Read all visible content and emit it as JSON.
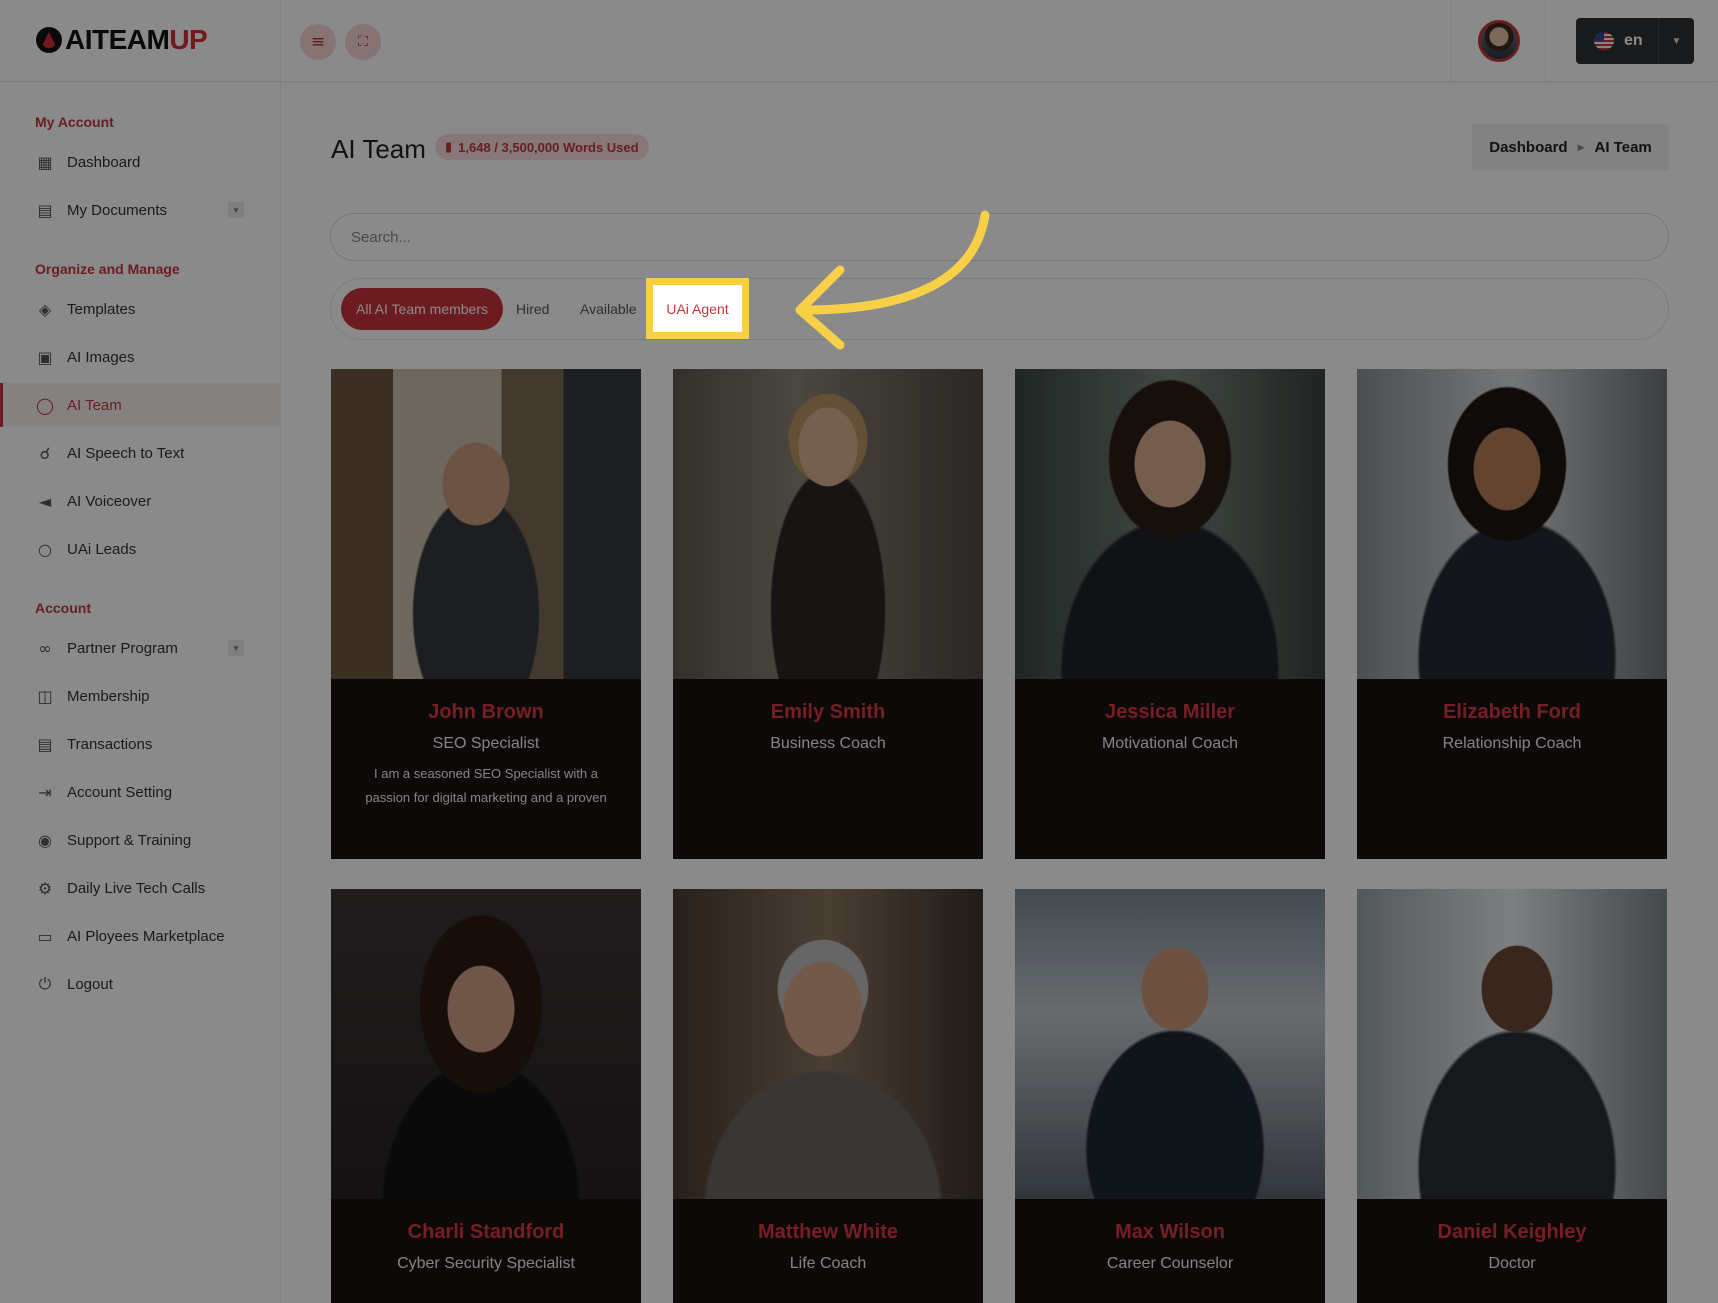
{
  "brand": {
    "name_main": "AITEAM",
    "name_accent": "UP"
  },
  "header": {
    "menu_icon": "hamburger-icon",
    "fullscreen_icon": "fullscreen-icon",
    "language_code": "en"
  },
  "sidebar": {
    "sections": [
      {
        "title": "My Account",
        "items": [
          {
            "label": "Dashboard",
            "icon": "grid-icon"
          },
          {
            "label": "My Documents",
            "icon": "document-icon",
            "has_dropdown": true
          }
        ]
      },
      {
        "title": "Organize and Manage",
        "items": [
          {
            "label": "Templates",
            "icon": "layers-icon"
          },
          {
            "label": "AI Images",
            "icon": "image-icon"
          },
          {
            "label": "AI Team",
            "icon": "chat-icon",
            "active": true
          },
          {
            "label": "AI Speech to Text",
            "icon": "headphones-icon"
          },
          {
            "label": "AI Voiceover",
            "icon": "speaker-icon"
          },
          {
            "label": "UAi Leads",
            "icon": "circle-icon"
          }
        ]
      },
      {
        "title": "Account",
        "items": [
          {
            "label": "Partner Program",
            "icon": "share-icon",
            "has_dropdown": true
          },
          {
            "label": "Membership",
            "icon": "gift-icon"
          },
          {
            "label": "Transactions",
            "icon": "receipt-icon"
          },
          {
            "label": "Account Setting",
            "icon": "exit-icon"
          },
          {
            "label": "Support & Training",
            "icon": "eye-icon"
          },
          {
            "label": "Daily Live Tech Calls",
            "icon": "gear-icon"
          },
          {
            "label": "AI Ployees Marketplace",
            "icon": "monitor-icon"
          },
          {
            "label": "Logout",
            "icon": "power-icon"
          }
        ]
      }
    ]
  },
  "page": {
    "title": "AI Team",
    "words_used": "1,648 / 3,500,000 Words Used",
    "breadcrumb": [
      "Dashboard",
      "AI Team"
    ]
  },
  "search": {
    "placeholder": "Search..."
  },
  "tabs": [
    {
      "label": "All AI Team members",
      "active": true
    },
    {
      "label": "Hired"
    },
    {
      "label": "Available"
    },
    {
      "label": "UAi Agent",
      "highlighted": true
    }
  ],
  "team": [
    {
      "name": "John Brown",
      "role": "SEO Specialist",
      "description": "I am a seasoned SEO Specialist with a passion for digital marketing and a proven"
    },
    {
      "name": "Emily Smith",
      "role": "Business Coach",
      "description": ""
    },
    {
      "name": "Jessica Miller",
      "role": "Motivational Coach",
      "description": ""
    },
    {
      "name": "Elizabeth Ford",
      "role": "Relationship Coach",
      "description": ""
    },
    {
      "name": "Charli Standford",
      "role": "Cyber Security Specialist",
      "description": ""
    },
    {
      "name": "Matthew White",
      "role": "Life Coach",
      "description": ""
    },
    {
      "name": "Max Wilson",
      "role": "Career Counselor",
      "description": ""
    },
    {
      "name": "Daniel Keighley",
      "role": "Doctor",
      "description": ""
    }
  ],
  "colors": {
    "accent": "#c8353e",
    "highlight": "#f7d048",
    "card_info_bg": "#1b1212"
  }
}
